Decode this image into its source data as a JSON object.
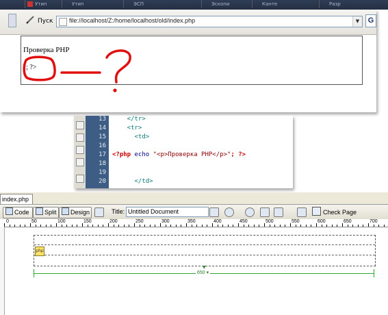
{
  "browser": {
    "tabs": [
      "Утип",
      "Утип",
      "ЭСП",
      "Эскопи",
      "Канте",
      "Разр"
    ],
    "go_label": "Пуск",
    "address": "file://localhost/Z:/home/localhost/old/index.php",
    "search_button": "G",
    "page": {
      "heading": "Проверка PHP",
      "leftover": "\"; ?>"
    },
    "annotation_color": "#e01010"
  },
  "code": {
    "lines": [
      {
        "num": "13",
        "text": "    </tr>"
      },
      {
        "num": "14",
        "text": "    <tr>"
      },
      {
        "num": "15",
        "text": "      <td>"
      },
      {
        "num": "16",
        "text": ""
      },
      {
        "num": "17",
        "text": "<?php echo \"<p>Проверка PHP</p>\"; ?>"
      },
      {
        "num": "18",
        "text": ""
      },
      {
        "num": "19",
        "text": ""
      },
      {
        "num": "20",
        "text": "      </td>"
      }
    ],
    "line17": {
      "open": "<?php",
      "echo": " echo ",
      "string": "\"<p>Проверка PHP</p>\"",
      "close": "; ?>"
    },
    "gutter_color": "#3d5d84"
  },
  "dreamweaver": {
    "doc_tab": "index.php",
    "toolbar": {
      "code": "Code",
      "split": "Split",
      "design": "Design",
      "title_label": "Title:",
      "title_value": "Untitled Document",
      "check_page": "Check Page"
    },
    "ruler_labels": [
      "0",
      "50",
      "100",
      "150",
      "200",
      "250",
      "300",
      "350",
      "400",
      "450",
      "500",
      "550",
      "600",
      "650",
      "700"
    ],
    "php_marker": "php",
    "table_width": "650 ▾"
  }
}
